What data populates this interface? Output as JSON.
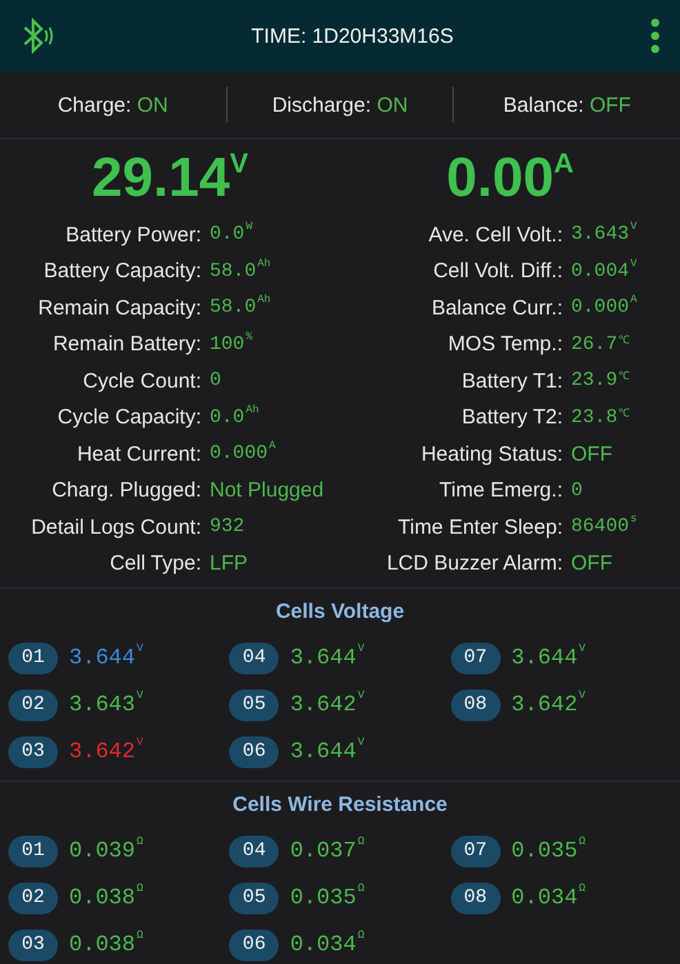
{
  "header": {
    "title": "TIME: 1D20H33M16S"
  },
  "switches": [
    {
      "label": "Charge:",
      "value": "ON"
    },
    {
      "label": "Discharge:",
      "value": "ON"
    },
    {
      "label": "Balance:",
      "value": "OFF"
    }
  ],
  "readings": [
    {
      "value": "29.14",
      "unit": "V"
    },
    {
      "value": "0.00",
      "unit": "A"
    }
  ],
  "parameters": [
    {
      "label": "Battery Power:",
      "value": "0.0",
      "unit": "W"
    },
    {
      "label": "Ave. Cell Volt.:",
      "value": "3.643",
      "unit": "V"
    },
    {
      "label": "Battery Capacity:",
      "value": "58.0",
      "unit": "Ah"
    },
    {
      "label": "Cell Volt. Diff.:",
      "value": "0.004",
      "unit": "V"
    },
    {
      "label": "Remain Capacity:",
      "value": "58.0",
      "unit": "Ah"
    },
    {
      "label": "Balance Curr.:",
      "value": "0.000",
      "unit": "A"
    },
    {
      "label": "Remain Battery:",
      "value": "100",
      "unit": "%"
    },
    {
      "label": "MOS Temp.:",
      "value": "26.7",
      "unit": "℃"
    },
    {
      "label": "Cycle Count:",
      "value": "0"
    },
    {
      "label": "Battery T1:",
      "value": "23.9",
      "unit": "℃"
    },
    {
      "label": "Cycle Capacity:",
      "value": "0.0",
      "unit": "Ah"
    },
    {
      "label": "Battery T2:",
      "value": "23.8",
      "unit": "℃"
    },
    {
      "label": "Heat Current:",
      "value": "0.000",
      "unit": "A"
    },
    {
      "label": "Heating Status:",
      "value": "OFF"
    },
    {
      "label": "Charg. Plugged:",
      "value": "Not Plugged"
    },
    {
      "label": "Time Emerg.:",
      "value": "0"
    },
    {
      "label": "Detail Logs Count:",
      "value": "932"
    },
    {
      "label": "Time Enter Sleep:",
      "value": "86400",
      "unit": "s"
    },
    {
      "label": "Cell Type:",
      "value": "LFP"
    },
    {
      "label": "LCD Buzzer Alarm:",
      "value": "OFF"
    }
  ],
  "sections": [
    {
      "title": "Cells Voltage",
      "cells": [
        {
          "index": "01",
          "value": "3.644",
          "unit": "V",
          "color": "#3b8ad6"
        },
        {
          "index": "02",
          "value": "3.643",
          "unit": "V",
          "color": "#4cb84c"
        },
        {
          "index": "03",
          "value": "3.642",
          "unit": "V",
          "color": "#e0292b"
        },
        {
          "index": "04",
          "value": "3.644",
          "unit": "V",
          "color": "#4cb84c"
        },
        {
          "index": "05",
          "value": "3.642",
          "unit": "V",
          "color": "#4cb84c"
        },
        {
          "index": "06",
          "value": "3.644",
          "unit": "V",
          "color": "#4cb84c"
        },
        {
          "index": "07",
          "value": "3.644",
          "unit": "V",
          "color": "#4cb84c"
        },
        {
          "index": "08",
          "value": "3.642",
          "unit": "V",
          "color": "#4cb84c"
        }
      ]
    },
    {
      "title": "Cells Wire Resistance",
      "cells": [
        {
          "index": "01",
          "value": "0.039",
          "unit": "Ω",
          "color": "#4cb84c"
        },
        {
          "index": "02",
          "value": "0.038",
          "unit": "Ω",
          "color": "#4cb84c"
        },
        {
          "index": "03",
          "value": "0.038",
          "unit": "Ω",
          "color": "#4cb84c"
        },
        {
          "index": "04",
          "value": "0.037",
          "unit": "Ω",
          "color": "#4cb84c"
        },
        {
          "index": "05",
          "value": "0.035",
          "unit": "Ω",
          "color": "#4cb84c"
        },
        {
          "index": "06",
          "value": "0.034",
          "unit": "Ω",
          "color": "#4cb84c"
        },
        {
          "index": "07",
          "value": "0.035",
          "unit": "Ω",
          "color": "#4cb84c"
        },
        {
          "index": "08",
          "value": "0.034",
          "unit": "Ω",
          "color": "#4cb84c"
        }
      ]
    }
  ]
}
